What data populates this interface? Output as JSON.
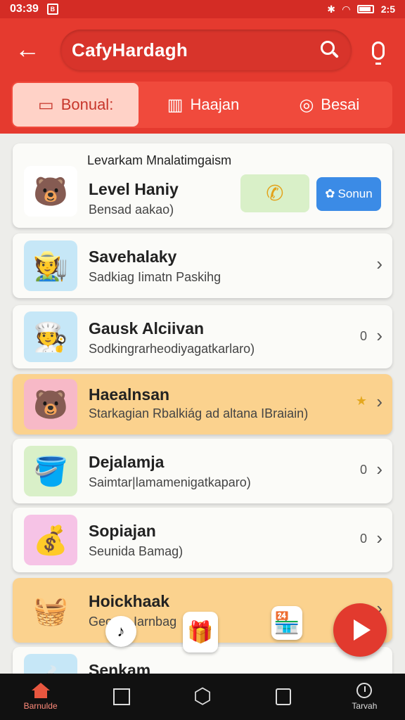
{
  "status_bar": {
    "time": "03:39",
    "battery_text": "2:5"
  },
  "header": {
    "title": "CafyHardagh",
    "back_icon": "arrow-left-icon",
    "search_icon": "search-icon",
    "mic_icon": "mic-icon"
  },
  "tabs": [
    {
      "label": "Bonual:",
      "icon": "message-icon",
      "active": true
    },
    {
      "label": "Haajan",
      "icon": "basket-icon",
      "active": false
    },
    {
      "label": "Besai",
      "icon": "refresh-icon",
      "active": false
    }
  ],
  "level_card": {
    "heading": "Levarkam Mnalatimgaism",
    "title": "Level Haniy",
    "subtitle": "Bensad aakao)",
    "call_icon": "phone-icon",
    "bonus_label": "Sonun"
  },
  "items": [
    {
      "title": "Savehalaky",
      "subtitle": "Sadkiag Iimatn Paskihg",
      "badge": "",
      "icon": "farmer-icon"
    },
    {
      "title": "Gausk Alciivan",
      "subtitle": "Sodkingrarheodiyagatkarlaro)",
      "badge": "0",
      "icon": "chef-icon"
    },
    {
      "title": "Haealnsan",
      "subtitle": "Starkagian Rbalkiág ad altana IBraiain)",
      "badge": "",
      "icon": "bear-icon"
    },
    {
      "title": "Dejalamja",
      "subtitle": "Saimtar|lamamenigatkaparo)",
      "badge": "0",
      "icon": "coin-bucket-icon"
    },
    {
      "title": "Sopiajan",
      "subtitle": "Seunida Bamag)",
      "badge": "0",
      "icon": "sack-icon"
    },
    {
      "title": "Hoickhaak",
      "subtitle": "Geou... Iarnbag",
      "badge": "",
      "icon": "basket-coins-icon"
    },
    {
      "title": "Senkam",
      "subtitle": "",
      "badge": "",
      "icon": "pot-icon"
    }
  ],
  "nav": [
    {
      "label": "Barnulde",
      "icon": "home-icon",
      "active": true
    },
    {
      "label": "",
      "icon": "square-icon",
      "active": false
    },
    {
      "label": "",
      "icon": "hexagon-icon",
      "active": false
    },
    {
      "label": "",
      "icon": "copy-icon",
      "active": false
    },
    {
      "label": "Tarvah",
      "icon": "clock-icon",
      "active": false
    }
  ]
}
